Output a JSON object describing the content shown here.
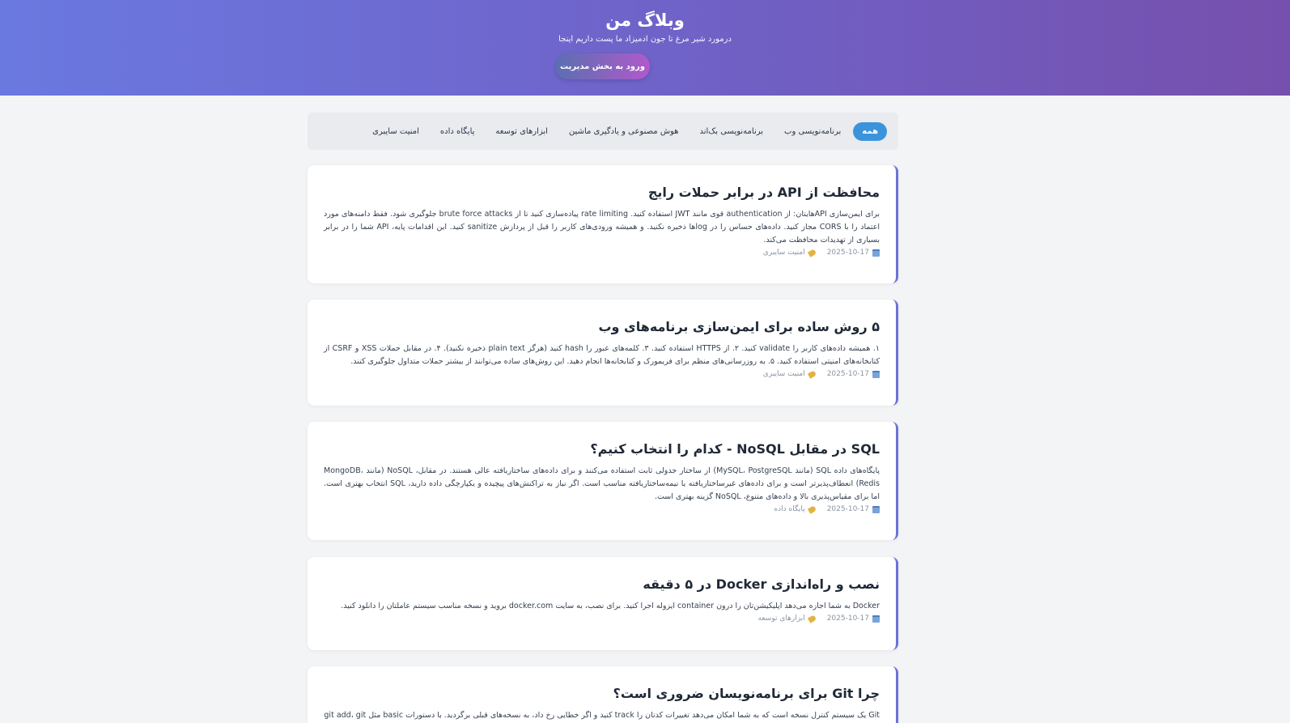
{
  "header": {
    "title": "وبلاگ من",
    "tagline": "درمورد شیر مرغ تا جون ادمیزاد ما پست داریم اینجا",
    "admin_button": "ورود به بخش مدیریت"
  },
  "categories": [
    {
      "label": "همه",
      "active": true
    },
    {
      "label": "برنامه‌نویسی وب"
    },
    {
      "label": "برنامه‌نویسی بک‌اند"
    },
    {
      "label": "هوش مصنوعی و یادگیری ماشین"
    },
    {
      "label": "ابزارهای توسعه"
    },
    {
      "label": "پایگاه داده"
    },
    {
      "label": "امنیت سایبری"
    }
  ],
  "posts": [
    {
      "title": "محافظت از API در برابر حملات رایج",
      "excerpt": "برای ایمن‌سازی APIهایتان: از authentication قوی مانند JWT استفاده کنید. rate limiting پیاده‌سازی کنید تا از brute force attacks جلوگیری شود. فقط دامنه‌های مورد اعتماد را با CORS مجاز کنید. داده‌های حساس را در logها ذخیره نکنید. و همیشه ورودی‌های کاربر را قبل از پردازش sanitize کنید. این اقدامات پایه، API شما را در برابر بسیاری از تهدیدات محافظت می‌کند.",
      "date": "2025-10-17",
      "category": "امنیت سایبری"
    },
    {
      "title": "۵ روش ساده برای ایمن‌سازی برنامه‌های وب",
      "excerpt": "۱. همیشه داده‌های کاربر را validate کنید. ۲. از HTTPS استفاده کنید. ۳. کلمه‌های عبور را hash کنید (هرگز plain text ذخیره نکنید). ۴. در مقابل حملات XSS و CSRF از کتابخانه‌های امنیتی استفاده کنید. ۵. به روزرسانی‌های منظم برای فریمورک و کتابخانه‌ها انجام دهید. این روش‌های ساده می‌توانند از بیشتر حملات متداول جلوگیری کنند.",
      "date": "2025-10-17",
      "category": "امنیت سایبری"
    },
    {
      "title": "SQL در مقابل NoSQL - کدام را انتخاب کنیم؟",
      "excerpt": "پایگاه‌های داده SQL (مانند MySQL، PostgreSQL) از ساختار جدولی ثابت استفاده می‌کنند و برای داده‌های ساختاریافته عالی هستند. در مقابل، NoSQL (مانند MongoDB، Redis) انعطاف‌پذیرتر است و برای داده‌های غیرساختاریافته یا نیمه‌ساختاریافته مناسب است. اگر نیاز به تراکنش‌های پیچیده و یکپارچگی داده دارید، SQL انتخاب بهتری است. اما برای مقیاس‌پذیری بالا و داده‌های متنوع، NoSQL گزینه بهتری است.",
      "date": "2025-10-17",
      "category": "پایگاه داده"
    },
    {
      "title": "نصب و راه‌اندازی Docker در ۵ دقیقه",
      "excerpt": "Docker به شما اجازه می‌دهد اپلیکیشن‌تان را درون container ایزوله اجرا کنید. برای نصب، به سایت docker.com بروید و نسخه مناسب سیستم عاملتان را دانلود کنید.",
      "date": "2025-10-17",
      "category": "ابزارهای توسعه"
    },
    {
      "title": "چرا Git برای برنامه‌نویسان ضروری است؟",
      "excerpt": "Git یک سیستم کنترل نسخه است که به شما امکان می‌دهد تغییرات کدتان را track کنید و اگر خطایی رخ داد، به نسخه‌های قبلی برگردید. با دستورات basic مثل git add، git",
      "date": "",
      "category": ""
    }
  ]
}
